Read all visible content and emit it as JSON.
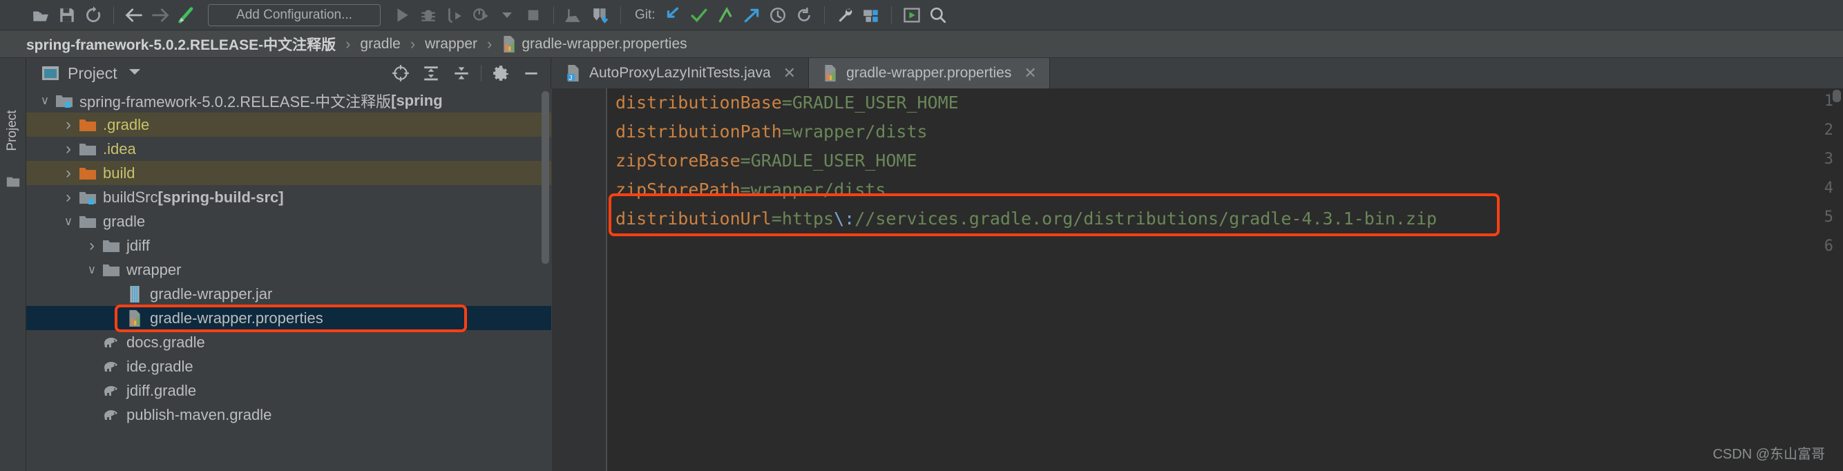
{
  "toolbar": {
    "icons": [
      {
        "name": "open-folder-icon"
      },
      {
        "name": "save-all-icon"
      },
      {
        "name": "sync-refresh-icon"
      },
      {
        "name": "separator"
      },
      {
        "name": "back-arrow-icon"
      },
      {
        "name": "forward-arrow-icon"
      },
      {
        "name": "update-project-icon"
      }
    ],
    "run_config_label": "Add Configuration...",
    "run_icons": [
      {
        "name": "run-icon"
      },
      {
        "name": "debug-icon"
      },
      {
        "name": "run-with-coverage-icon"
      },
      {
        "name": "profile-icon"
      },
      {
        "name": "dropdown-caret-icon"
      },
      {
        "name": "stop-icon"
      },
      {
        "name": "separator"
      },
      {
        "name": "update-project-grey-icon"
      },
      {
        "name": "vcs-update-icon"
      }
    ],
    "git_label": "Git:",
    "git_icons": [
      {
        "name": "vcs-update-blue-icon"
      },
      {
        "name": "commit-check-icon"
      },
      {
        "name": "push-arrow-icon"
      },
      {
        "name": "pull-arrow-icon"
      },
      {
        "name": "history-clock-icon"
      },
      {
        "name": "rollback-icon"
      },
      {
        "name": "separator"
      },
      {
        "name": "wrench-settings-icon"
      },
      {
        "name": "project-structure-icon"
      },
      {
        "name": "separator"
      },
      {
        "name": "run-anything-icon"
      },
      {
        "name": "search-everywhere-icon"
      }
    ]
  },
  "breadcrumb": {
    "items": [
      {
        "label": "spring-framework-5.0.2.RELEASE-中文注释版",
        "bold": true,
        "icon": null
      },
      {
        "label": "gradle",
        "bold": false,
        "icon": null
      },
      {
        "label": "wrapper",
        "bold": false,
        "icon": null
      },
      {
        "label": "gradle-wrapper.properties",
        "bold": false,
        "icon": "properties-file-icon"
      }
    ],
    "separator": "›"
  },
  "left_strip": {
    "vertical_tab_label": "Project",
    "bottom_icon": "structure-icon"
  },
  "project_panel": {
    "title": "Project",
    "window_icon": "project-window-icon",
    "caret": "▾",
    "tools": [
      {
        "name": "locate-in-tree-icon"
      },
      {
        "name": "expand-all-icon"
      },
      {
        "name": "collapse-all-icon"
      },
      {
        "name": "settings-gear-icon"
      },
      {
        "name": "hide-panel-icon"
      }
    ],
    "tree": [
      {
        "indent": 0,
        "arrow": "expanded",
        "icon": "module-folder-icon",
        "label": "spring-framework-5.0.2.RELEASE-中文注释版 ",
        "suffix": "[spring",
        "style": "normal",
        "bg": "none"
      },
      {
        "indent": 1,
        "arrow": "collapsed",
        "icon": "orange-folder-icon",
        "label": ".gradle",
        "suffix": "",
        "style": "yellow",
        "bg": "olive"
      },
      {
        "indent": 1,
        "arrow": "collapsed",
        "icon": "grey-folder-icon",
        "label": ".idea",
        "suffix": "",
        "style": "yellow",
        "bg": "none"
      },
      {
        "indent": 1,
        "arrow": "collapsed",
        "icon": "orange-folder-icon",
        "label": "build",
        "suffix": "",
        "style": "yellow",
        "bg": "olive"
      },
      {
        "indent": 1,
        "arrow": "collapsed",
        "icon": "module-folder-icon",
        "label": "buildSrc ",
        "suffix": "[spring-build-src]",
        "style": "normal",
        "bg": "none"
      },
      {
        "indent": 1,
        "arrow": "expanded",
        "icon": "grey-folder-icon",
        "label": "gradle",
        "suffix": "",
        "style": "normal",
        "bg": "none"
      },
      {
        "indent": 2,
        "arrow": "collapsed",
        "icon": "grey-folder-icon",
        "label": "jdiff",
        "suffix": "",
        "style": "normal",
        "bg": "none"
      },
      {
        "indent": 2,
        "arrow": "expanded",
        "icon": "grey-folder-icon",
        "label": "wrapper",
        "suffix": "",
        "style": "normal",
        "bg": "none"
      },
      {
        "indent": 3,
        "arrow": "none",
        "icon": "jar-file-icon",
        "label": "gradle-wrapper.jar",
        "suffix": "",
        "style": "normal",
        "bg": "none"
      },
      {
        "indent": 3,
        "arrow": "none",
        "icon": "properties-file-icon",
        "label": "gradle-wrapper.properties",
        "suffix": "",
        "style": "normal",
        "bg": "selected"
      },
      {
        "indent": 2,
        "arrow": "none",
        "icon": "gradle-file-icon",
        "label": "docs.gradle",
        "suffix": "",
        "style": "normal",
        "bg": "none"
      },
      {
        "indent": 2,
        "arrow": "none",
        "icon": "gradle-file-icon",
        "label": "ide.gradle",
        "suffix": "",
        "style": "normal",
        "bg": "none"
      },
      {
        "indent": 2,
        "arrow": "none",
        "icon": "gradle-file-icon",
        "label": "jdiff.gradle",
        "suffix": "",
        "style": "normal",
        "bg": "none"
      },
      {
        "indent": 2,
        "arrow": "none",
        "icon": "gradle-file-icon",
        "label": "publish-maven.gradle",
        "suffix": "",
        "style": "normal",
        "bg": "none"
      }
    ]
  },
  "editor": {
    "tabs": [
      {
        "label": "AutoProxyLazyInitTests.java",
        "icon": "java-file-icon",
        "active": false,
        "close": "✕"
      },
      {
        "label": "gradle-wrapper.properties",
        "icon": "properties-file-icon",
        "active": true,
        "close": "✕"
      }
    ],
    "line_numbers": [
      "1",
      "2",
      "3",
      "4",
      "5",
      "6"
    ],
    "lines": [
      {
        "key": "distributionBase",
        "eq": "=",
        "value": "GRADLE_USER_HOME"
      },
      {
        "key": "distributionPath",
        "eq": "=",
        "value": "wrapper/dists"
      },
      {
        "key": "zipStoreBase",
        "eq": "=",
        "value": "GRADLE_USER_HOME"
      },
      {
        "key": "zipStorePath",
        "eq": "=",
        "value": "wrapper/dists"
      },
      {
        "key": "distributionUrl",
        "eq": "=",
        "value_pre": "https",
        "escape": "\\:",
        "value_post": "//services.gradle.org/distributions/gradle-4.3.1-bin.zip"
      },
      {
        "key": "",
        "eq": "",
        "value": ""
      }
    ]
  },
  "annotations": {
    "highlight_color": "#ff4013"
  },
  "watermark": "CSDN @东山富哥"
}
